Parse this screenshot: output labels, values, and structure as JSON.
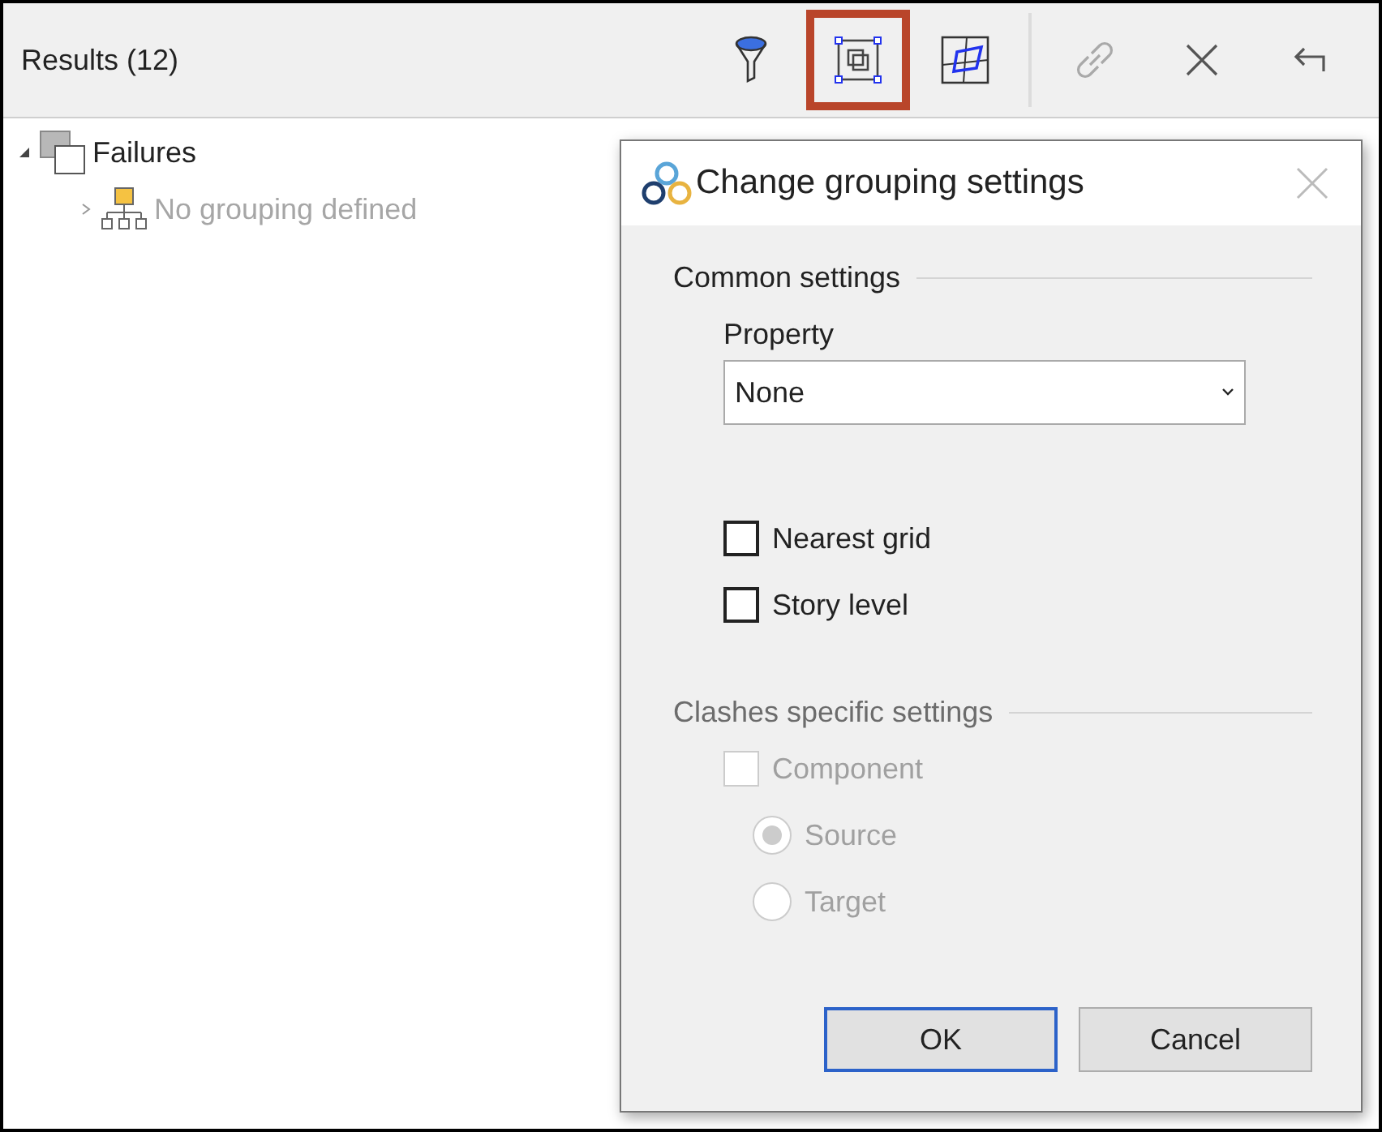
{
  "panel": {
    "title": "Results (12)"
  },
  "toolbar": [
    {
      "kind": "filter",
      "selected": false,
      "disabled": false
    },
    {
      "kind": "grouping",
      "selected": true,
      "disabled": false
    },
    {
      "kind": "area",
      "selected": false,
      "disabled": false
    },
    {
      "kind": "link",
      "selected": false,
      "disabled": true
    },
    {
      "kind": "close",
      "selected": false,
      "disabled": false
    },
    {
      "kind": "back",
      "selected": false,
      "disabled": false
    }
  ],
  "tree": [
    {
      "label": "Failures",
      "expanded": true,
      "disabled": false,
      "children": [
        {
          "label": "No grouping defined",
          "expanded": false,
          "disabled": true
        }
      ]
    }
  ],
  "dialog": {
    "title": "Change grouping settings",
    "sections": [
      {
        "title": "Common settings",
        "disabled": false,
        "items": [
          {
            "kind": "select",
            "label": "Property",
            "value": "None"
          },
          {
            "kind": "checkbox",
            "label": "Nearest grid",
            "checked": false
          },
          {
            "kind": "checkbox",
            "label": "Story level",
            "checked": false
          }
        ]
      },
      {
        "title": "Clashes specific settings",
        "disabled": true,
        "items": [
          {
            "kind": "checkbox",
            "label": "Component",
            "checked": false
          },
          {
            "kind": "radio",
            "label": "Source",
            "selected": true
          },
          {
            "kind": "radio",
            "label": "Target",
            "selected": false
          }
        ]
      }
    ],
    "buttons": [
      {
        "label": "OK",
        "default": true
      },
      {
        "label": "Cancel",
        "default": false
      }
    ]
  }
}
